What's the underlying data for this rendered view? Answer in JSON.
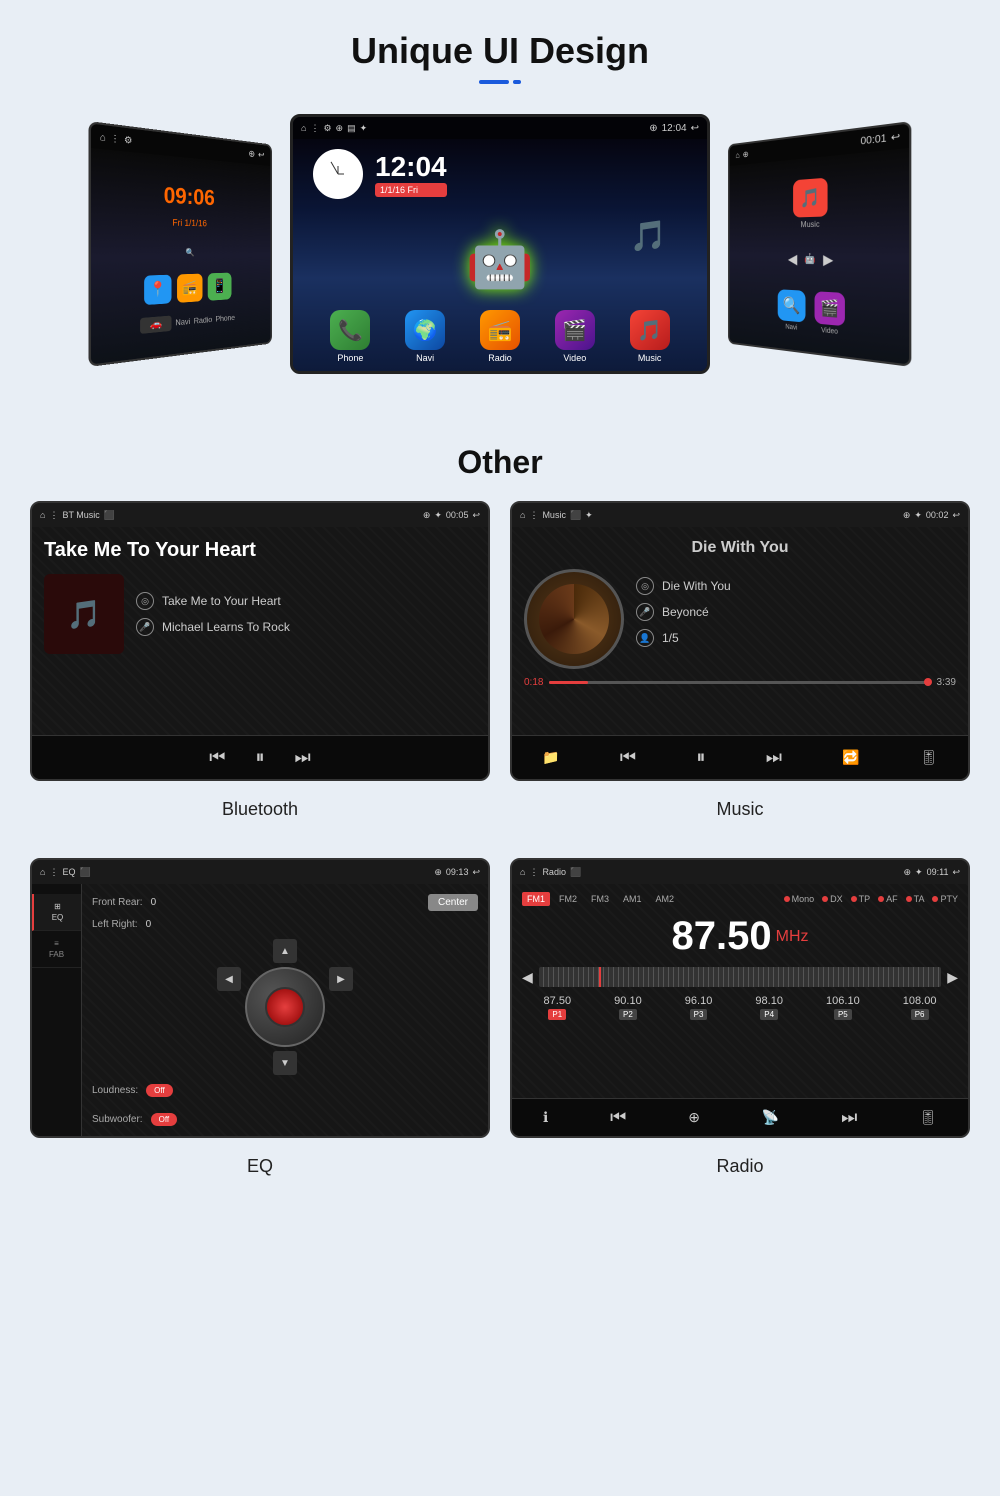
{
  "page": {
    "background": "#e8eef5"
  },
  "section1": {
    "title": "Unique UI Design",
    "underline": true,
    "left_screen": {
      "time": "09:06",
      "date": "Fri 1/1/16",
      "apps": [
        "Navi",
        "Radio",
        "Phone"
      ]
    },
    "center_screen": {
      "time": "12:04",
      "date": "1/1/16 Fri",
      "apps": [
        {
          "label": "Phone",
          "color": "#4CAF50"
        },
        {
          "label": "Navi",
          "color": "#2196F3"
        },
        {
          "label": "Radio",
          "color": "#FF9800"
        },
        {
          "label": "Video",
          "color": "#9C27B0"
        },
        {
          "label": "Music",
          "color": "#F44336"
        }
      ]
    },
    "right_screen": {
      "apps_top": [
        "Music",
        "Music"
      ],
      "apps_bottom": [
        "Navi",
        "Video"
      ]
    }
  },
  "section2": {
    "title": "Other",
    "bt_screen": {
      "topbar_left": "BT Music",
      "topbar_time": "00:05",
      "title": "Take Me To Your Heart",
      "track": "Take Me to Your Heart",
      "artist": "Michael Learns To Rock",
      "controls": [
        "prev",
        "pause",
        "next"
      ]
    },
    "music_screen": {
      "topbar_left": "Music",
      "topbar_time": "00:02",
      "title": "Die With You",
      "track": "Die With You",
      "artist": "Beyoncé",
      "track_num": "1/5",
      "progress_current": "0:18",
      "progress_total": "3:39",
      "controls": [
        "folder",
        "prev",
        "pause",
        "next",
        "repeat",
        "eq"
      ]
    },
    "bt_caption": "Bluetooth",
    "music_caption": "Music",
    "eq_screen": {
      "topbar_left": "EQ",
      "topbar_time": "09:13",
      "front_rear_label": "Front Rear:",
      "front_rear_value": "0",
      "left_right_label": "Left Right:",
      "left_right_value": "0",
      "center_btn": "Center",
      "loudness_label": "Loudness:",
      "loudness_value": "Off",
      "subwoofer_label": "Subwoofer:",
      "subwoofer_value": "Off",
      "sidebar": [
        {
          "label": "EQ",
          "active": true
        },
        {
          "label": "FAB",
          "active": false
        }
      ]
    },
    "radio_screen": {
      "topbar_left": "Radio",
      "topbar_time": "09:11",
      "bands": [
        "FM1",
        "FM2",
        "FM3",
        "AM1",
        "AM2"
      ],
      "active_band": "FM1",
      "options": [
        "Mono",
        "DX",
        "TP",
        "AF",
        "TA",
        "PTY"
      ],
      "frequency": "87.50",
      "unit": "MHz",
      "presets": [
        {
          "freq": "87.50",
          "label": "P1",
          "active": true
        },
        {
          "freq": "90.10",
          "label": "P2",
          "active": false
        },
        {
          "freq": "96.10",
          "label": "P3",
          "active": false
        },
        {
          "freq": "98.10",
          "label": "P4",
          "active": false
        },
        {
          "freq": "106.10",
          "label": "P5",
          "active": false
        },
        {
          "freq": "108.00",
          "label": "P6",
          "active": false
        }
      ]
    },
    "eq_caption": "EQ",
    "radio_caption": "Radio"
  }
}
